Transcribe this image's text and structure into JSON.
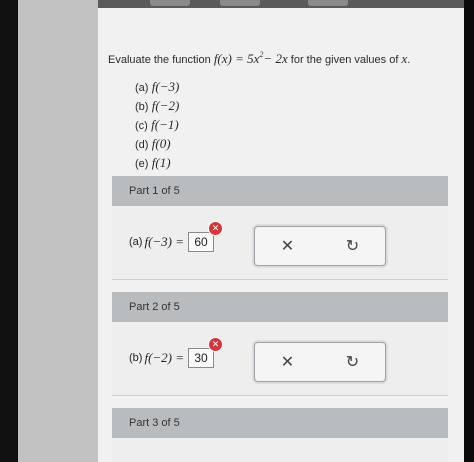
{
  "problem": {
    "intro": "Evaluate the function",
    "function_lhs": "f(x)",
    "eq": " = ",
    "term1": "5x",
    "exp": "2",
    "term2": "− 2x",
    "outro": "for the given values of",
    "var": "x",
    "period": "."
  },
  "sub_items": [
    {
      "label": "(a)",
      "expr": "f(−3)"
    },
    {
      "label": "(b)",
      "expr": "f(−2)"
    },
    {
      "label": "(c)",
      "expr": "f(−1)"
    },
    {
      "label": "(d)",
      "expr": "f(0)"
    },
    {
      "label": "(e)",
      "expr": "f(1)"
    }
  ],
  "parts": [
    {
      "header": "Part 1 of 5",
      "label": "(a)",
      "expr": "f(−3) =",
      "answer": "60"
    },
    {
      "header": "Part 2 of 5",
      "label": "(b)",
      "expr": "f(−2) =",
      "answer": "30"
    },
    {
      "header": "Part 3 of 5"
    }
  ],
  "icons": {
    "error": "✕",
    "clear": "✕",
    "undo": "↻"
  },
  "colors": {
    "error_badge": "#d7343a",
    "part_header_bg": "#b9bcbf"
  }
}
